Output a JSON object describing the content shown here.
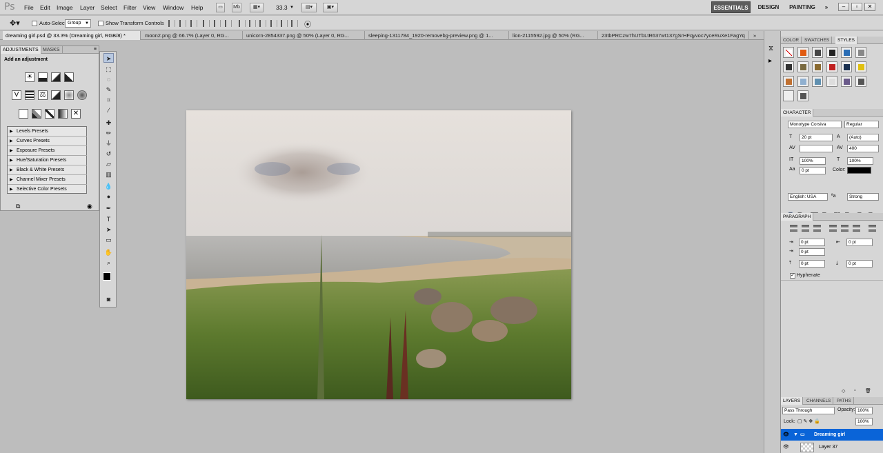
{
  "app": {
    "brand": "Ps"
  },
  "menu": [
    "File",
    "Edit",
    "Image",
    "Layer",
    "Select",
    "Filter",
    "View",
    "Window",
    "Help"
  ],
  "topbar": {
    "zoom": "33.3",
    "workspaces": [
      "ESSENTIALS",
      "DESIGN",
      "PAINTING"
    ],
    "more": "»"
  },
  "options": {
    "auto_select_label": "Auto-Select:",
    "auto_select_value": "Group",
    "show_transform_label": "Show Transform Controls"
  },
  "tabs": [
    "dreaming girl.psd @ 33.3% (Dreaming girl, RGB/8) *",
    "moon2.png @ 66.7% (Layer 0, RG...",
    "unicorn-2854337.png @ 50% (Layer 0, RG...",
    "sleeping-1311784_1920-removebg-preview.png @ 1...",
    "lion-2115592.jpg @ 50% (RG...",
    "23tbPRCzw7hUTbLtR637wt137gSrHFqyvoc7yceRuXe1FagYq"
  ],
  "adjustments": {
    "tabs": [
      "ADJUSTMENTS",
      "MASKS"
    ],
    "heading": "Add an adjustment",
    "presets": [
      "Levels Presets",
      "Curves Presets",
      "Exposure Presets",
      "Hue/Saturation Presets",
      "Black & White Presets",
      "Channel Mixer Presets",
      "Selective Color Presets"
    ]
  },
  "styles_panel": {
    "tabs": [
      "COLOR",
      "SWATCHES",
      "STYLES"
    ]
  },
  "character": {
    "title": "CHARACTER",
    "font_family": "Monotype Corsiva",
    "font_style": "Regular",
    "size": "20 pt",
    "leading": "(Auto)",
    "tracking": "400",
    "vscale": "100%",
    "hscale": "100%",
    "baseline": "0 pt",
    "color_label": "Color:",
    "text_color": "#000000",
    "language": "English: USA",
    "antialias": "Strong"
  },
  "paragraph": {
    "title": "PARAGRAPH",
    "indent_left": "0 pt",
    "indent_right": "0 pt",
    "indent_first": "0 pt",
    "space_before": "0 pt",
    "space_after": "0 pt",
    "hyphenate_label": "Hyphenate"
  },
  "layers": {
    "tabs": [
      "LAYERS",
      "CHANNELS",
      "PATHS"
    ],
    "blend_mode": "Pass Through",
    "opacity_label": "Opacity:",
    "opacity": "100%",
    "lock_label": "Lock:",
    "fill": "100%",
    "items": [
      "Dreaming girl",
      "Layer 37"
    ]
  }
}
